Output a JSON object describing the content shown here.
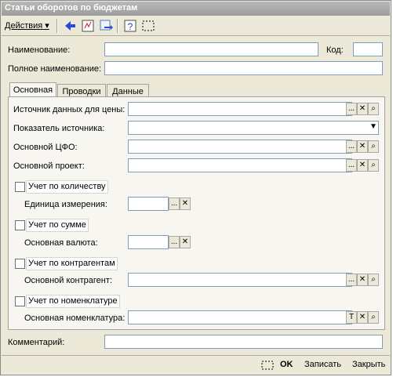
{
  "window": {
    "title": "Статьи оборотов по бюджетам"
  },
  "toolbar": {
    "actions_label": "Действия",
    "icons": [
      "arrow-left-icon",
      "spreadsheet-icon",
      "sync-arrows-icon",
      "help-icon",
      "selection-icon"
    ]
  },
  "form": {
    "name_label": "Наименование:",
    "code_label": "Код:",
    "fullname_label": "Полное наименование:",
    "comment_label": "Комментарий:"
  },
  "tabs": [
    "Основная",
    "Проводки",
    "Данные"
  ],
  "panel": {
    "price_source_label": "Источник данных для цены:",
    "source_indicator_label": "Показатель источника:",
    "main_cfo_label": "Основной ЦФО:",
    "main_project_label": "Основной проект:",
    "qty_check_label": "Учет по количеству",
    "unit_label": "Единица измерения:",
    "sum_check_label": "Учет по сумме",
    "currency_label": "Основная валюта:",
    "contractor_check_label": "Учет по контрагентам",
    "contractor_label": "Основной контрагент:",
    "nomenclature_check_label": "Учет по номенклатуре",
    "nomenclature_label": "Основная номенклатура:"
  },
  "buttons": {
    "ok": "OK",
    "save": "Записать",
    "close": "Закрыть"
  },
  "glyphs": {
    "ellipsis": "...",
    "clear": "✕",
    "search": "🔍",
    "type": "T",
    "dropdown": "▼"
  }
}
